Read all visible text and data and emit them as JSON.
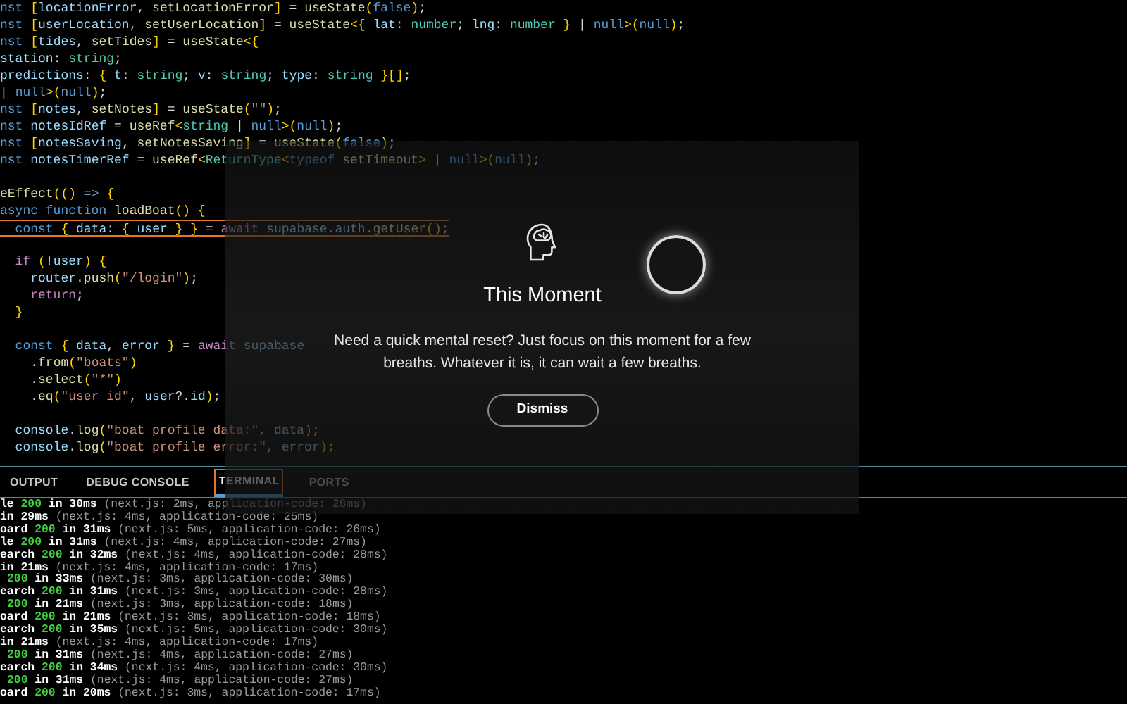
{
  "editor": {
    "blocks": [
      [
        {
          "current": false,
          "tokens": [
            {
              "kind": "kw",
              "t": "nst "
            },
            {
              "kind": "brace",
              "t": "["
            },
            {
              "kind": "var",
              "t": "locationError"
            },
            {
              "kind": "op",
              "t": ", "
            },
            {
              "kind": "fn",
              "t": "setLocationError"
            },
            {
              "kind": "brace",
              "t": "]"
            },
            {
              "kind": "op",
              "t": " = "
            },
            {
              "kind": "fn",
              "t": "useState"
            },
            {
              "kind": "brace",
              "t": "("
            },
            {
              "kind": "kw",
              "t": "false"
            },
            {
              "kind": "brace",
              "t": ")"
            },
            {
              "kind": "op",
              "t": ";"
            }
          ]
        },
        {
          "current": false,
          "tokens": [
            {
              "kind": "kw",
              "t": "nst "
            },
            {
              "kind": "brace",
              "t": "["
            },
            {
              "kind": "var",
              "t": "userLocation"
            },
            {
              "kind": "op",
              "t": ", "
            },
            {
              "kind": "fn",
              "t": "setUserLocation"
            },
            {
              "kind": "brace",
              "t": "]"
            },
            {
              "kind": "op",
              "t": " = "
            },
            {
              "kind": "fn",
              "t": "useState"
            },
            {
              "kind": "brace",
              "t": "<{ "
            },
            {
              "kind": "var",
              "t": "lat"
            },
            {
              "kind": "op",
              "t": ": "
            },
            {
              "kind": "type",
              "t": "number"
            },
            {
              "kind": "op",
              "t": "; "
            },
            {
              "kind": "var",
              "t": "lng"
            },
            {
              "kind": "op",
              "t": ": "
            },
            {
              "kind": "type",
              "t": "number"
            },
            {
              "kind": "brace",
              "t": " }"
            },
            {
              "kind": "op",
              "t": " | "
            },
            {
              "kind": "kw",
              "t": "null"
            },
            {
              "kind": "brace",
              "t": ">("
            },
            {
              "kind": "kw",
              "t": "null"
            },
            {
              "kind": "brace",
              "t": ")"
            },
            {
              "kind": "op",
              "t": ";"
            }
          ]
        },
        {
          "current": false,
          "tokens": [
            {
              "kind": "kw",
              "t": "nst "
            },
            {
              "kind": "brace",
              "t": "["
            },
            {
              "kind": "var",
              "t": "tides"
            },
            {
              "kind": "op",
              "t": ", "
            },
            {
              "kind": "fn",
              "t": "setTides"
            },
            {
              "kind": "brace",
              "t": "]"
            },
            {
              "kind": "op",
              "t": " = "
            },
            {
              "kind": "fn",
              "t": "useState"
            },
            {
              "kind": "brace",
              "t": "<{"
            }
          ]
        },
        {
          "current": false,
          "tokens": [
            {
              "kind": "var",
              "t": "station"
            },
            {
              "kind": "op",
              "t": ": "
            },
            {
              "kind": "type",
              "t": "string"
            },
            {
              "kind": "op",
              "t": ";"
            }
          ]
        },
        {
          "current": false,
          "tokens": [
            {
              "kind": "var",
              "t": "predictions"
            },
            {
              "kind": "op",
              "t": ": "
            },
            {
              "kind": "brace",
              "t": "{ "
            },
            {
              "kind": "var",
              "t": "t"
            },
            {
              "kind": "op",
              "t": ": "
            },
            {
              "kind": "type",
              "t": "string"
            },
            {
              "kind": "op",
              "t": "; "
            },
            {
              "kind": "var",
              "t": "v"
            },
            {
              "kind": "op",
              "t": ": "
            },
            {
              "kind": "type",
              "t": "string"
            },
            {
              "kind": "op",
              "t": "; "
            },
            {
              "kind": "var",
              "t": "type"
            },
            {
              "kind": "op",
              "t": ": "
            },
            {
              "kind": "type",
              "t": "string"
            },
            {
              "kind": "brace",
              "t": " }[]"
            },
            {
              "kind": "op",
              "t": ";"
            }
          ]
        },
        {
          "current": false,
          "tokens": [
            {
              "kind": "op",
              "t": "| "
            },
            {
              "kind": "kw",
              "t": "null"
            },
            {
              "kind": "brace",
              "t": ">("
            },
            {
              "kind": "kw",
              "t": "null"
            },
            {
              "kind": "brace",
              "t": ")"
            },
            {
              "kind": "op",
              "t": ";"
            }
          ]
        },
        {
          "current": false,
          "tokens": [
            {
              "kind": "kw",
              "t": "nst "
            },
            {
              "kind": "brace",
              "t": "["
            },
            {
              "kind": "var",
              "t": "notes"
            },
            {
              "kind": "op",
              "t": ", "
            },
            {
              "kind": "fn",
              "t": "setNotes"
            },
            {
              "kind": "brace",
              "t": "]"
            },
            {
              "kind": "op",
              "t": " = "
            },
            {
              "kind": "fn",
              "t": "useState"
            },
            {
              "kind": "brace",
              "t": "("
            },
            {
              "kind": "str",
              "t": "\"\""
            },
            {
              "kind": "brace",
              "t": ")"
            },
            {
              "kind": "op",
              "t": ";"
            }
          ]
        },
        {
          "current": false,
          "tokens": [
            {
              "kind": "kw",
              "t": "nst "
            },
            {
              "kind": "var",
              "t": "notesIdRef"
            },
            {
              "kind": "op",
              "t": " = "
            },
            {
              "kind": "fn",
              "t": "useRef"
            },
            {
              "kind": "brace",
              "t": "<"
            },
            {
              "kind": "type",
              "t": "string"
            },
            {
              "kind": "op",
              "t": " | "
            },
            {
              "kind": "kw",
              "t": "null"
            },
            {
              "kind": "brace",
              "t": ">("
            },
            {
              "kind": "kw",
              "t": "null"
            },
            {
              "kind": "brace",
              "t": ")"
            },
            {
              "kind": "op",
              "t": ";"
            }
          ]
        },
        {
          "current": false,
          "tokens": [
            {
              "kind": "kw",
              "t": "nst "
            },
            {
              "kind": "brace",
              "t": "["
            },
            {
              "kind": "var",
              "t": "notesSaving"
            },
            {
              "kind": "op",
              "t": ", "
            },
            {
              "kind": "fn",
              "t": "setNotesSaving"
            },
            {
              "kind": "brace",
              "t": "]"
            },
            {
              "kind": "op",
              "t": " = "
            },
            {
              "kind": "fn",
              "t": "useState"
            },
            {
              "kind": "brace",
              "t": "("
            },
            {
              "kind": "kw",
              "t": "false"
            },
            {
              "kind": "brace",
              "t": ")"
            },
            {
              "kind": "op",
              "t": ";"
            }
          ]
        },
        {
          "current": false,
          "tokens": [
            {
              "kind": "kw",
              "t": "nst "
            },
            {
              "kind": "var",
              "t": "notesTimerRef"
            },
            {
              "kind": "op",
              "t": " = "
            },
            {
              "kind": "fn",
              "t": "useRef"
            },
            {
              "kind": "brace",
              "t": "<"
            },
            {
              "kind": "type",
              "t": "ReturnType"
            },
            {
              "kind": "brace",
              "t": "<"
            },
            {
              "kind": "kw",
              "t": "typeof "
            },
            {
              "kind": "fn",
              "t": "setTimeout"
            },
            {
              "kind": "brace",
              "t": ">"
            },
            {
              "kind": "op",
              "t": " | "
            },
            {
              "kind": "kw",
              "t": "null"
            },
            {
              "kind": "brace",
              "t": ">("
            },
            {
              "kind": "kw",
              "t": "null"
            },
            {
              "kind": "brace",
              "t": ")"
            },
            {
              "kind": "op",
              "t": ";"
            }
          ]
        }
      ],
      [
        {
          "current": false,
          "tokens": [
            {
              "kind": "fn",
              "t": "eEffect"
            },
            {
              "kind": "brace",
              "t": "(() "
            },
            {
              "kind": "kw",
              "t": "=>"
            },
            {
              "kind": "brace",
              "t": " {"
            }
          ]
        },
        {
          "current": false,
          "tokens": [
            {
              "kind": "kw",
              "t": "async function "
            },
            {
              "kind": "fn",
              "t": "loadBoat"
            },
            {
              "kind": "brace",
              "t": "() {"
            }
          ]
        },
        {
          "current": true,
          "tokens": [
            {
              "kind": "kw",
              "t": "  const "
            },
            {
              "kind": "brace",
              "t": "{ "
            },
            {
              "kind": "var",
              "t": "data"
            },
            {
              "kind": "op",
              "t": ": "
            },
            {
              "kind": "brace",
              "t": "{ "
            },
            {
              "kind": "var",
              "t": "user"
            },
            {
              "kind": "brace",
              "t": " } }"
            },
            {
              "kind": "op",
              "t": " = "
            },
            {
              "kind": "ctl",
              "t": "await "
            },
            {
              "kind": "var",
              "t": "supabase"
            },
            {
              "kind": "op",
              "t": "."
            },
            {
              "kind": "var",
              "t": "auth"
            },
            {
              "kind": "op",
              "t": "."
            },
            {
              "kind": "fn",
              "t": "getUser"
            },
            {
              "kind": "brace",
              "t": "()"
            },
            {
              "kind": "op",
              "t": ";"
            }
          ]
        }
      ],
      [
        {
          "current": false,
          "tokens": [
            {
              "kind": "ctl",
              "t": "  if "
            },
            {
              "kind": "brace",
              "t": "("
            },
            {
              "kind": "op",
              "t": "!"
            },
            {
              "kind": "var",
              "t": "user"
            },
            {
              "kind": "brace",
              "t": ") {"
            }
          ]
        },
        {
          "current": false,
          "tokens": [
            {
              "kind": "var",
              "t": "    router"
            },
            {
              "kind": "op",
              "t": "."
            },
            {
              "kind": "fn",
              "t": "push"
            },
            {
              "kind": "brace",
              "t": "("
            },
            {
              "kind": "str",
              "t": "\"/login\""
            },
            {
              "kind": "brace",
              "t": ")"
            },
            {
              "kind": "op",
              "t": ";"
            }
          ]
        },
        {
          "current": false,
          "tokens": [
            {
              "kind": "ctl",
              "t": "    return"
            },
            {
              "kind": "op",
              "t": ";"
            }
          ]
        },
        {
          "current": false,
          "tokens": [
            {
              "kind": "brace",
              "t": "  }"
            }
          ]
        }
      ],
      [
        {
          "current": false,
          "tokens": [
            {
              "kind": "kw",
              "t": "  const "
            },
            {
              "kind": "brace",
              "t": "{ "
            },
            {
              "kind": "var",
              "t": "data"
            },
            {
              "kind": "op",
              "t": ", "
            },
            {
              "kind": "var",
              "t": "error"
            },
            {
              "kind": "brace",
              "t": " }"
            },
            {
              "kind": "op",
              "t": " = "
            },
            {
              "kind": "ctl",
              "t": "await "
            },
            {
              "kind": "var",
              "t": "supabase"
            }
          ]
        },
        {
          "current": false,
          "tokens": [
            {
              "kind": "op",
              "t": "    ."
            },
            {
              "kind": "fn",
              "t": "from"
            },
            {
              "kind": "brace",
              "t": "("
            },
            {
              "kind": "str",
              "t": "\"boats\""
            },
            {
              "kind": "brace",
              "t": ")"
            }
          ]
        },
        {
          "current": false,
          "tokens": [
            {
              "kind": "op",
              "t": "    ."
            },
            {
              "kind": "fn",
              "t": "select"
            },
            {
              "kind": "brace",
              "t": "("
            },
            {
              "kind": "str",
              "t": "\"*\""
            },
            {
              "kind": "brace",
              "t": ")"
            }
          ]
        },
        {
          "current": false,
          "tokens": [
            {
              "kind": "op",
              "t": "    ."
            },
            {
              "kind": "fn",
              "t": "eq"
            },
            {
              "kind": "brace",
              "t": "("
            },
            {
              "kind": "str",
              "t": "\"user_id\""
            },
            {
              "kind": "op",
              "t": ", "
            },
            {
              "kind": "var",
              "t": "user"
            },
            {
              "kind": "op",
              "t": "?."
            },
            {
              "kind": "var",
              "t": "id"
            },
            {
              "kind": "brace",
              "t": ")"
            },
            {
              "kind": "op",
              "t": ";"
            }
          ]
        }
      ],
      [
        {
          "current": false,
          "tokens": [
            {
              "kind": "var",
              "t": "  console"
            },
            {
              "kind": "op",
              "t": "."
            },
            {
              "kind": "fn",
              "t": "log"
            },
            {
              "kind": "brace",
              "t": "("
            },
            {
              "kind": "str",
              "t": "\"boat profile data:\""
            },
            {
              "kind": "op",
              "t": ", "
            },
            {
              "kind": "var",
              "t": "data"
            },
            {
              "kind": "brace",
              "t": ")"
            },
            {
              "kind": "op",
              "t": ";"
            }
          ]
        },
        {
          "current": false,
          "tokens": [
            {
              "kind": "var",
              "t": "  console"
            },
            {
              "kind": "op",
              "t": "."
            },
            {
              "kind": "fn",
              "t": "log"
            },
            {
              "kind": "brace",
              "t": "("
            },
            {
              "kind": "str",
              "t": "\"boat profile error:\""
            },
            {
              "kind": "op",
              "t": ", "
            },
            {
              "kind": "var",
              "t": "error"
            },
            {
              "kind": "brace",
              "t": ")"
            },
            {
              "kind": "op",
              "t": ";"
            }
          ]
        }
      ]
    ]
  },
  "panel": {
    "tabs": [
      {
        "label": "OUTPUT",
        "selected": false
      },
      {
        "label": "DEBUG CONSOLE",
        "selected": false
      },
      {
        "label": "TERMINAL",
        "selected": true
      },
      {
        "label": "PORTS",
        "selected": false
      }
    ],
    "terminal": [
      {
        "prefix": "le",
        "status": "200",
        "time": "in 30ms",
        "detail": "(next.js: 2ms, application-code: 28ms)"
      },
      {
        "time": "in 29ms",
        "detail": "(next.js: 4ms, application-code: 25ms)"
      },
      {
        "prefix": "oard",
        "status": "200",
        "time": "in 31ms",
        "detail": "(next.js: 5ms, application-code: 26ms)"
      },
      {
        "prefix": "le",
        "status": "200",
        "time": "in 31ms",
        "detail": "(next.js: 4ms, application-code: 27ms)"
      },
      {
        "prefix": "earch",
        "status": "200",
        "time": "in 32ms",
        "detail": "(next.js: 4ms, application-code: 28ms)"
      },
      {
        "time": "in 21ms",
        "detail": "(next.js: 4ms, application-code: 17ms)"
      },
      {
        "status": "200",
        "time": "in 33ms",
        "detail": "(next.js: 3ms, application-code: 30ms)"
      },
      {
        "prefix": "earch",
        "status": "200",
        "time": "in 31ms",
        "detail": "(next.js: 3ms, application-code: 28ms)"
      },
      {
        "status": "200",
        "time": "in 21ms",
        "detail": "(next.js: 3ms, application-code: 18ms)"
      },
      {
        "prefix": "oard",
        "status": "200",
        "time": "in 21ms",
        "detail": "(next.js: 3ms, application-code: 18ms)"
      },
      {
        "prefix": "earch",
        "status": "200",
        "time": "in 35ms",
        "detail": "(next.js: 5ms, application-code: 30ms)"
      },
      {
        "time": "in 21ms",
        "detail": "(next.js: 4ms, application-code: 17ms)"
      },
      {
        "status": "200",
        "time": "in 31ms",
        "detail": "(next.js: 4ms, application-code: 27ms)"
      },
      {
        "prefix": "earch",
        "status": "200",
        "time": "in 34ms",
        "detail": "(next.js: 4ms, application-code: 30ms)"
      },
      {
        "status": "200",
        "time": "in 31ms",
        "detail": "(next.js: 4ms, application-code: 27ms)"
      },
      {
        "prefix": "oard",
        "status": "200",
        "time": "in 20ms",
        "detail": "(next.js: 3ms, application-code: 17ms)"
      }
    ]
  },
  "modal": {
    "title": "This Moment",
    "body": "Need a quick mental reset? Just focus on this moment for a few breaths. Whatever it is, it can wait a few breaths.",
    "button": "Dismiss"
  }
}
